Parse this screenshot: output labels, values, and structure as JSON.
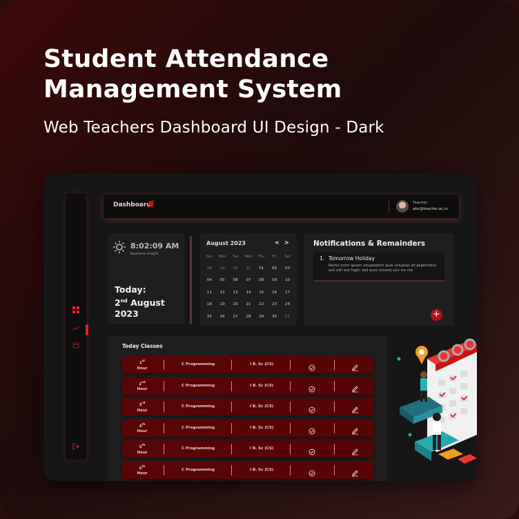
{
  "headline": {
    "title_line1": "Student Attendance",
    "title_line2": "Management System",
    "subtitle": "Web Teachers Dashboard UI Design - Dark"
  },
  "sidebar": {
    "items": [
      {
        "icon": "grid-icon",
        "active": true
      },
      {
        "icon": "chart-icon",
        "active": false
      },
      {
        "icon": "calendar-icon",
        "active": false
      }
    ],
    "bottom_icon": "logout-icon"
  },
  "topbar": {
    "title": "Dashboard",
    "user_role": "Teacher",
    "user_email": "abc@teacher.ac.in"
  },
  "time_card": {
    "time": "8:02:09 AM",
    "caption": "Realtime Insight",
    "today_label": "Today:",
    "day_num": "2",
    "day_suffix": "nd",
    "month": "August",
    "year": "2023"
  },
  "calendar": {
    "month_label": "August 2023",
    "prev": "<",
    "next": ">",
    "weekdays": [
      "Sun",
      "Mon",
      "Tue",
      "Wed",
      "Thu",
      "Fri",
      "Sat"
    ],
    "weeks": [
      [
        "28",
        "29",
        "30",
        "31",
        "01",
        "02",
        "03"
      ],
      [
        "04",
        "05",
        "06",
        "07",
        "08",
        "09",
        "10"
      ],
      [
        "11",
        "12",
        "13",
        "14",
        "15",
        "16",
        "17"
      ],
      [
        "18",
        "19",
        "20",
        "21",
        "22",
        "23",
        "24"
      ],
      [
        "25",
        "26",
        "27",
        "28",
        "29",
        "30",
        "01"
      ]
    ],
    "selected": "02"
  },
  "notifications": {
    "title": "Notifications & Remainders",
    "items": [
      {
        "num": "1.",
        "title": "Tomorrow Holiday",
        "body": "Nemo enim ipsam voluptatem quia voluptas sit aspernatur aut odit aut fugit, sed quia conseq uun tur ma"
      }
    ],
    "add_label": "+"
  },
  "classes": {
    "title": "Today Classes",
    "rows": [
      {
        "num": "1",
        "suffix": "st",
        "hour": "Hour",
        "subject": "C Programming",
        "class": "I B. Sc (CS)"
      },
      {
        "num": "2",
        "suffix": "nd",
        "hour": "Hour",
        "subject": "C Programming",
        "class": "I B. Sc (CS)"
      },
      {
        "num": "3",
        "suffix": "rd",
        "hour": "Hour",
        "subject": "C Programming",
        "class": "I B. Sc (CS)"
      },
      {
        "num": "4",
        "suffix": "th",
        "hour": "Hour",
        "subject": "C Programming",
        "class": "I B. Sc (CS)"
      },
      {
        "num": "5",
        "suffix": "th",
        "hour": "Hour",
        "subject": "C Programming",
        "class": "I B. Sc (CS)"
      },
      {
        "num": "6",
        "suffix": "th",
        "hour": "Hour",
        "subject": "C Programming",
        "class": "I B. Sc (CS)"
      }
    ]
  },
  "colors": {
    "accent": "#d41d1d",
    "row_bg": "#5a0505",
    "panel": "#1e1e1e",
    "background": "#2a0c0c"
  }
}
